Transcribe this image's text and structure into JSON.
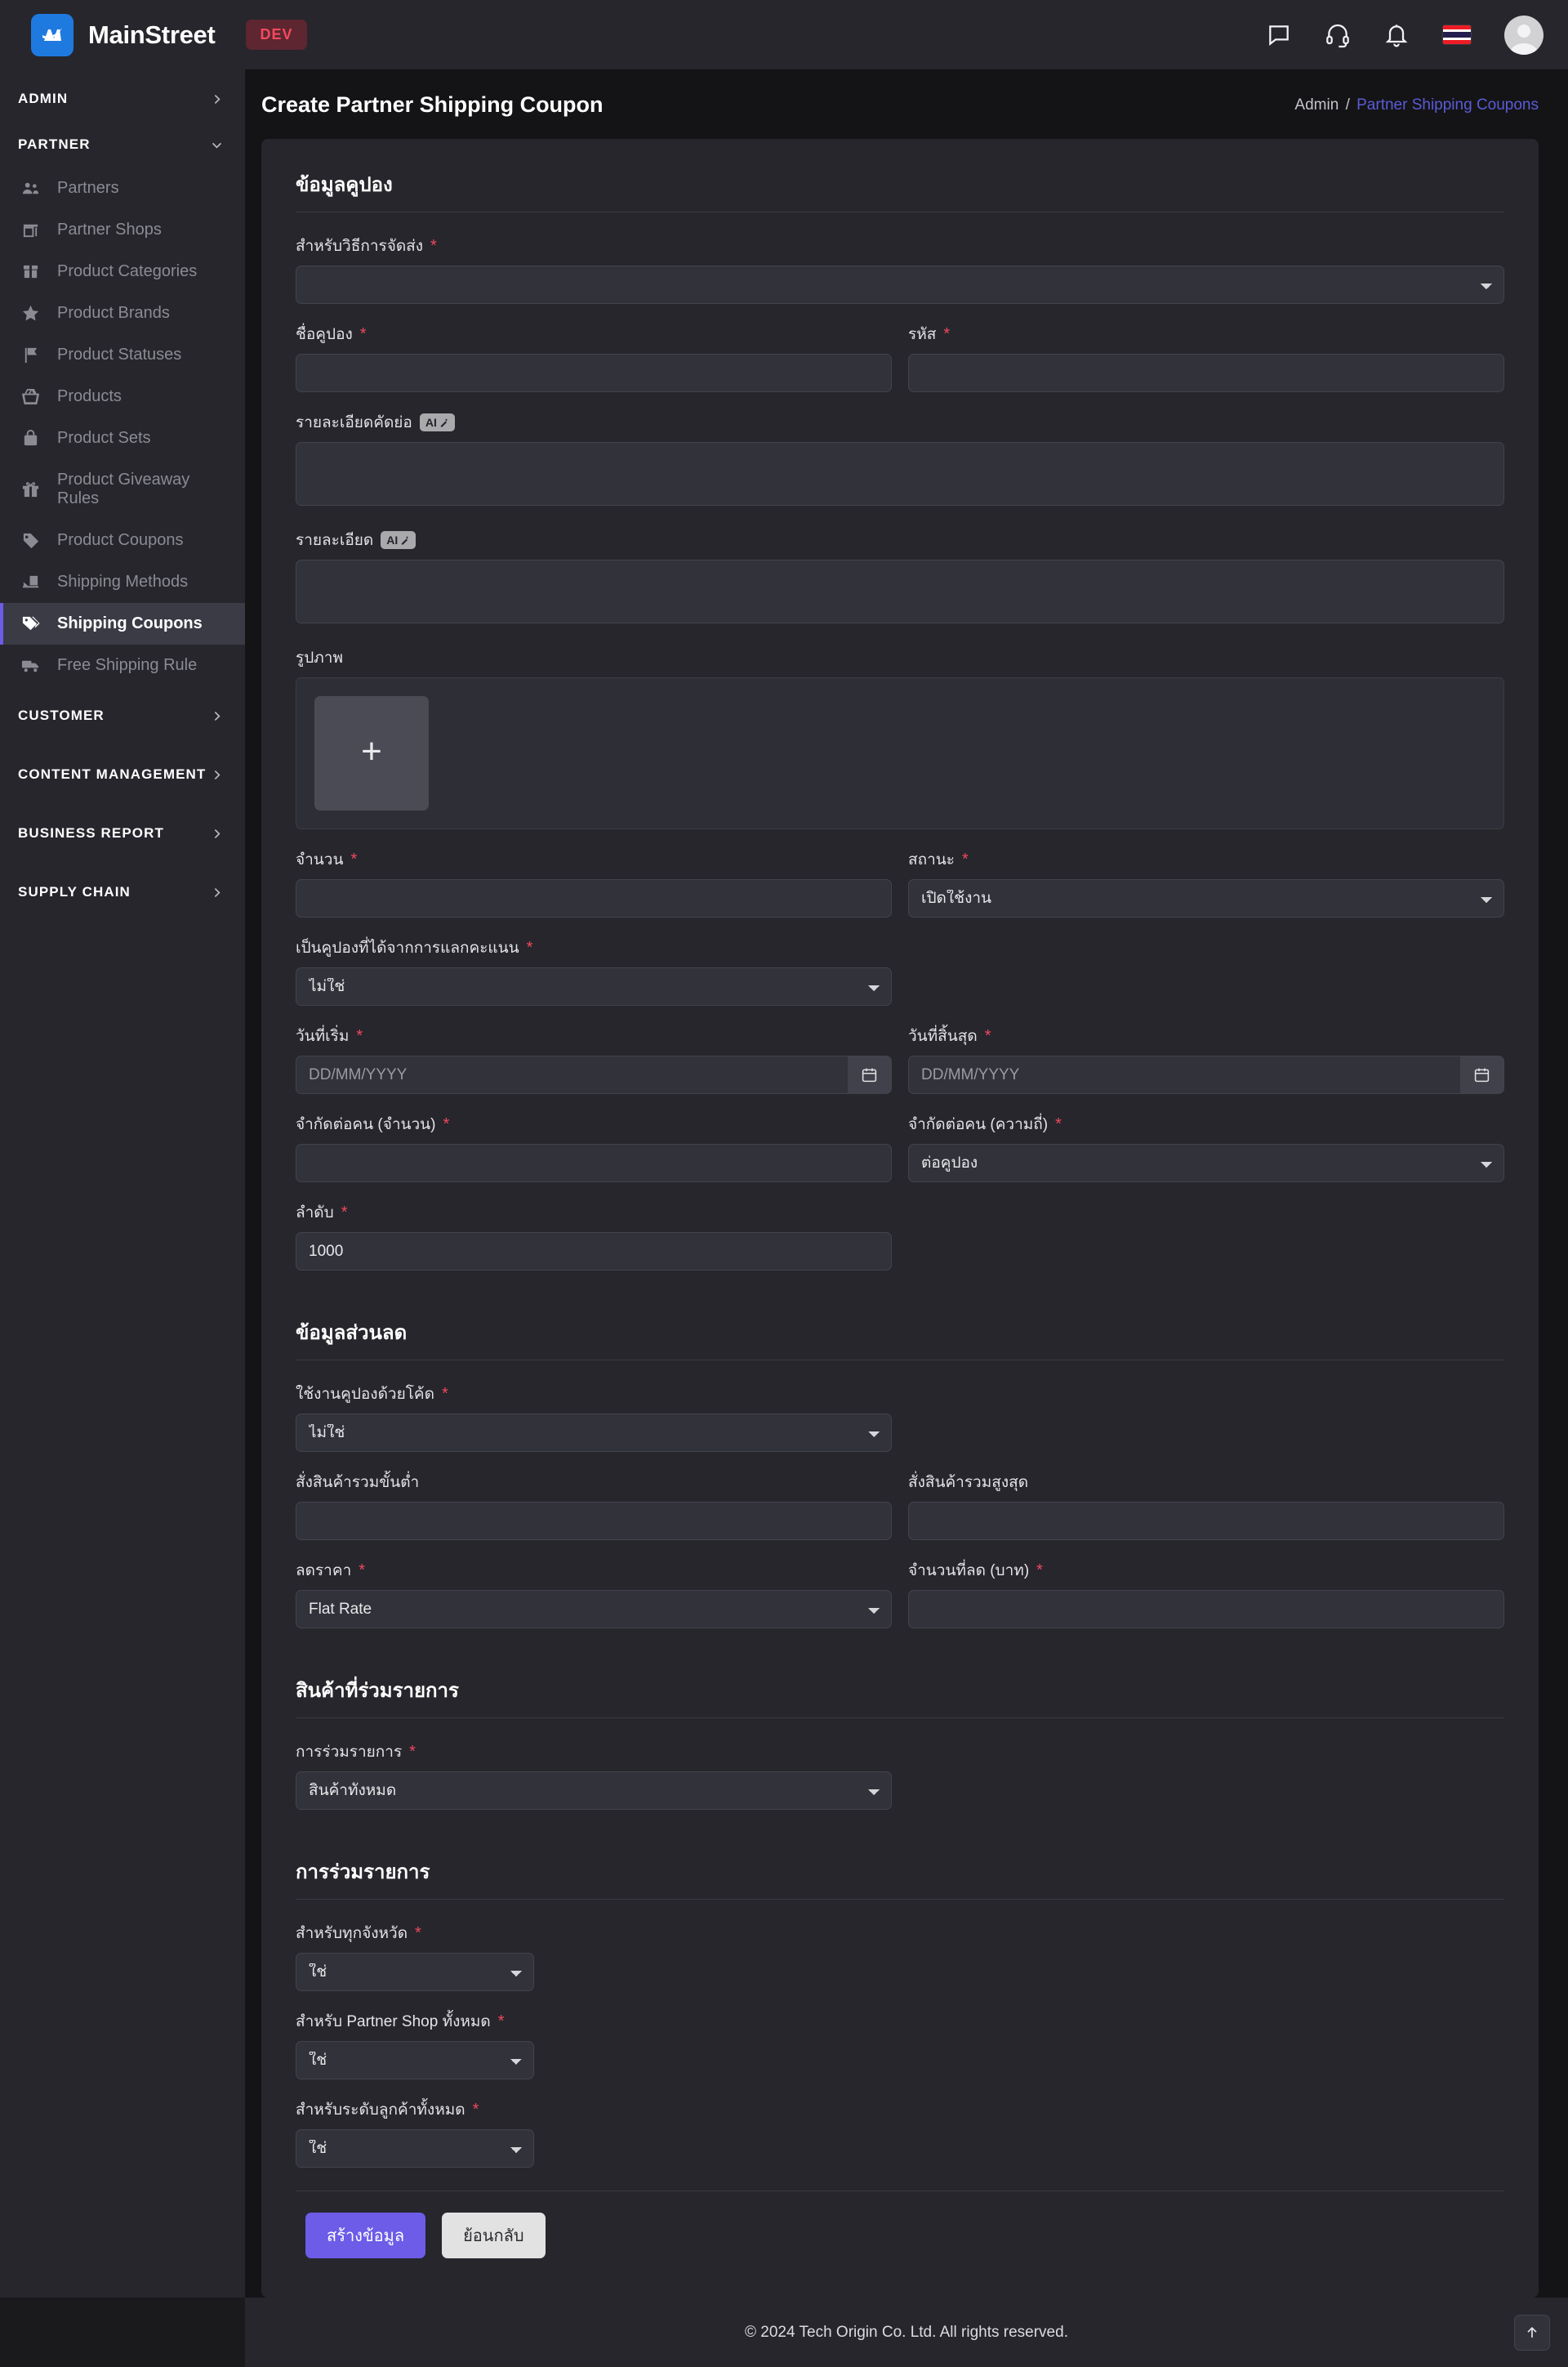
{
  "topbar": {
    "brand_name": "MainStreet",
    "env_badge": "DEV",
    "icons": [
      "chat-icon",
      "headset-support-icon",
      "bell-notification-icon",
      "thai-flag-icon",
      "user-avatar"
    ]
  },
  "sidebar": {
    "groups": [
      {
        "label": "ADMIN",
        "expanded": false
      },
      {
        "label": "PARTNER",
        "expanded": true
      }
    ],
    "partner_items": [
      {
        "label": "Partners",
        "icon": "users-icon",
        "active": false
      },
      {
        "label": "Partner Shops",
        "icon": "storefront-icon",
        "active": false
      },
      {
        "label": "Product Categories",
        "icon": "box-icon",
        "active": false
      },
      {
        "label": "Product Brands",
        "icon": "star-icon",
        "active": false
      },
      {
        "label": "Product Statuses",
        "icon": "flag-icon",
        "active": false
      },
      {
        "label": "Products",
        "icon": "basket-icon",
        "active": false
      },
      {
        "label": "Product Sets",
        "icon": "bag-icon",
        "active": false
      },
      {
        "label": "Product Giveaway Rules",
        "icon": "gift-icon",
        "active": false
      },
      {
        "label": "Product Coupons",
        "icon": "tag-icon",
        "active": false
      },
      {
        "label": "Shipping Methods",
        "icon": "truck-loading-icon",
        "active": false
      },
      {
        "label": "Shipping Coupons",
        "icon": "tags-icon",
        "active": true
      },
      {
        "label": "Free Shipping Rule",
        "icon": "delivery-truck-icon",
        "active": false
      }
    ],
    "bottom_groups": [
      {
        "label": "CUSTOMER"
      },
      {
        "label": "CONTENT MANAGEMENT"
      },
      {
        "label": "BUSINESS REPORT"
      },
      {
        "label": "SUPPLY CHAIN"
      }
    ]
  },
  "page": {
    "title": "Create Partner Shipping Coupon",
    "breadcrumb_root": "Admin",
    "breadcrumb_sep": "/",
    "breadcrumb_current": "Partner Shipping Coupons"
  },
  "form": {
    "section_coupon_info": "ข้อมูลคูปอง",
    "section_discount_info": "ข้อมูลส่วนลด",
    "section_products": "สินค้าที่ร่วมรายการ",
    "section_participation": "การร่วมรายการ",
    "shipping_method": {
      "label": "สำหรับวิธีการจัดส่ง",
      "required": true,
      "value": ""
    },
    "coupon_name": {
      "label": "ชื่อคูปอง",
      "required": true,
      "value": ""
    },
    "code": {
      "label": "รหัส",
      "required": true,
      "value": ""
    },
    "short_description": {
      "label": "รายละเอียดคัดย่อ",
      "required": false,
      "value": "",
      "ai_chip": "AI"
    },
    "description": {
      "label": "รายละเอียด",
      "required": false,
      "value": "",
      "ai_chip": "AI"
    },
    "image": {
      "label": "รูปภาพ",
      "required": false,
      "add_label": "+"
    },
    "quantity": {
      "label": "จำนวน",
      "required": true,
      "value": ""
    },
    "status": {
      "label": "สถานะ",
      "required": true,
      "value": "เปิดใช้งาน"
    },
    "is_redeem_coupon": {
      "label": "เป็นคูปองที่ได้จากการแลกคะแนน",
      "required": true,
      "value": "ไม่ใช่"
    },
    "start_date": {
      "label": "วันที่เริ่ม",
      "required": true,
      "value": "",
      "placeholder": "DD/MM/YYYY"
    },
    "end_date": {
      "label": "วันที่สิ้นสุด",
      "required": true,
      "value": "",
      "placeholder": "DD/MM/YYYY"
    },
    "limit_per_person_qty": {
      "label": "จำกัดต่อคน (จำนวน)",
      "required": true,
      "value": ""
    },
    "limit_per_person_freq": {
      "label": "จำกัดต่อคน (ความถี่)",
      "required": true,
      "value": "ต่อคูปอง"
    },
    "order": {
      "label": "ลำดับ",
      "required": true,
      "value": "1000"
    },
    "use_with_code": {
      "label": "ใช้งานคูปองด้วยโค้ด",
      "required": true,
      "value": "ไม่ใช่"
    },
    "min_order_total": {
      "label": "สั่งสินค้ารวมขั้นต่ำ",
      "required": false,
      "value": ""
    },
    "max_order_total": {
      "label": "สั่งสินค้ารวมสูงสุด",
      "required": false,
      "value": ""
    },
    "discount_type": {
      "label": "ลดราคา",
      "required": true,
      "value": "Flat Rate"
    },
    "discount_amount": {
      "label": "จำนวนที่ลด (บาท)",
      "required": true,
      "value": ""
    },
    "participation_type": {
      "label": "การร่วมรายการ",
      "required": true,
      "value": "สินค้าทั้งหมด"
    },
    "all_provinces": {
      "label": "สำหรับทุกจังหวัด",
      "required": true,
      "value": "ใช่"
    },
    "all_partner_shops": {
      "label": "สำหรับ Partner Shop ทั้งหมด",
      "required": true,
      "value": "ใช่"
    },
    "all_customer_tiers": {
      "label": "สำหรับระดับลูกค้าทั้งหมด",
      "required": true,
      "value": "ใช่"
    },
    "submit_label": "สร้างข้อมูล",
    "back_label": "ย้อนกลับ"
  },
  "footer": {
    "copyright": "© 2024 Tech Origin Co. Ltd. All rights reserved."
  },
  "colors": {
    "accent": "#6c5ce7",
    "link": "#5b5bd6",
    "required": "#f0485e",
    "brand": "#1f7ae0",
    "dev_badge": "#f34a5e"
  }
}
